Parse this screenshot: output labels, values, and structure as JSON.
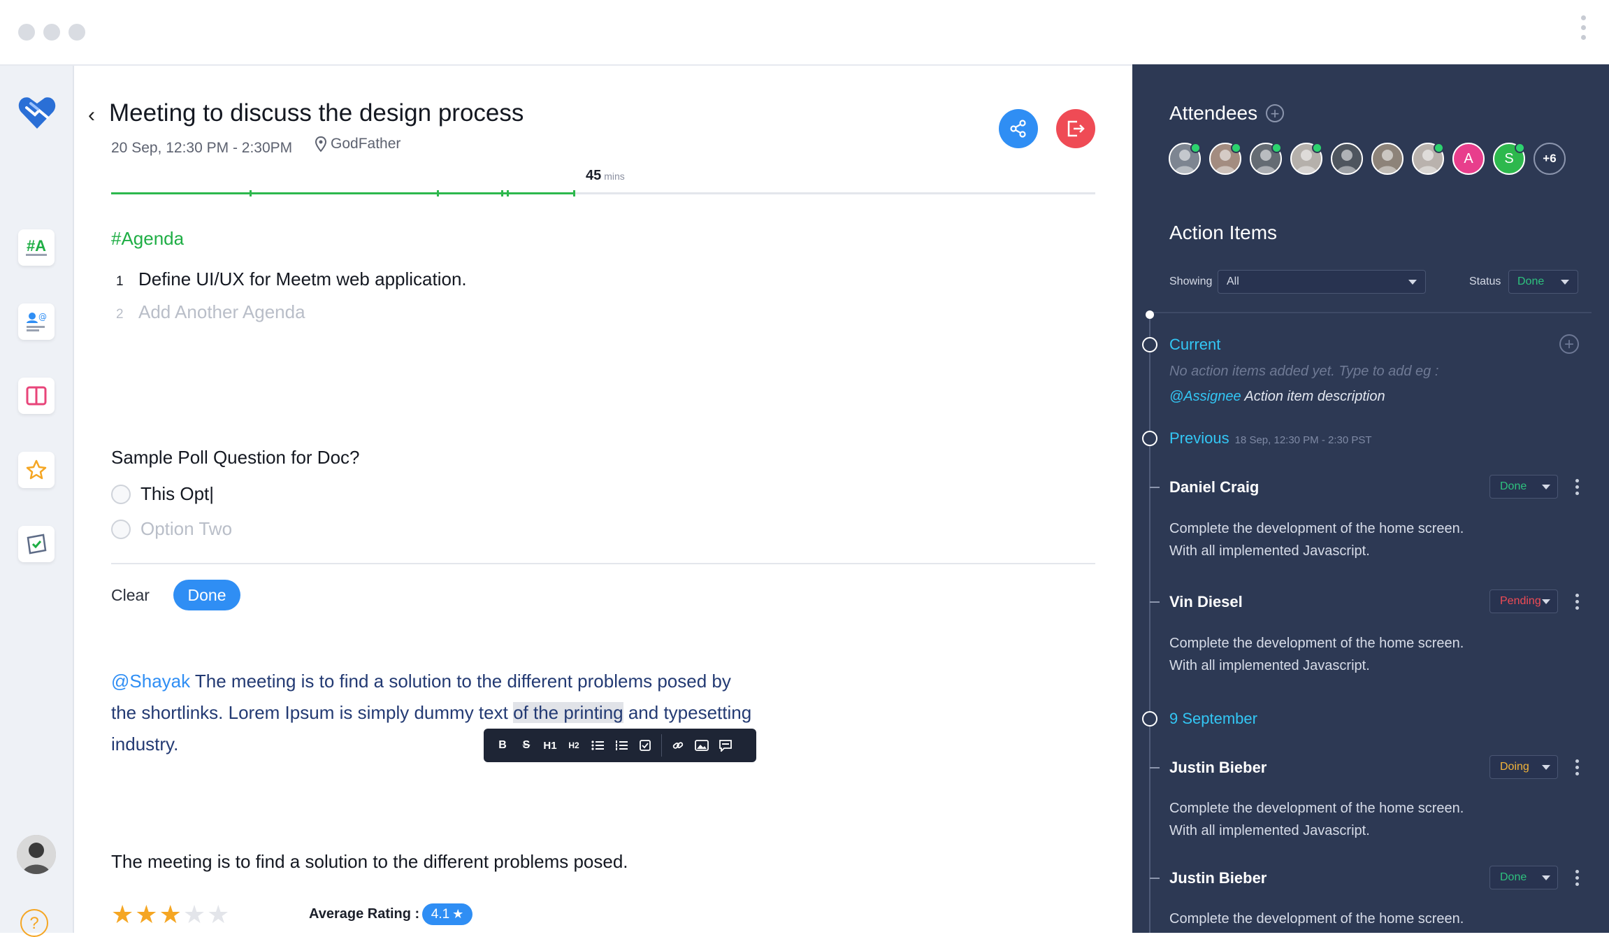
{
  "colors": {
    "accent_blue": "#2f8ef4",
    "agenda_green": "#1fae45",
    "danger_red": "#ef4b55",
    "panel_bg": "#2d3954",
    "cyan": "#33c7f5",
    "status_done": "#2ec27e",
    "status_pending": "#ef4b55",
    "status_doing": "#f2b43a",
    "star": "#f5a623"
  },
  "sidebar": {
    "logo_icon": "heart-handshake-icon",
    "items": [
      {
        "name": "agenda-hashtag-icon",
        "label": "#A"
      },
      {
        "name": "people-mention-icon"
      },
      {
        "name": "split-layout-icon"
      },
      {
        "name": "star-icon"
      },
      {
        "name": "inbox-check-icon"
      }
    ],
    "bottom": [
      {
        "name": "user-avatar"
      },
      {
        "name": "help-icon",
        "label": "?"
      }
    ]
  },
  "meeting": {
    "title": "Meeting to discuss the design process",
    "datetime": "20 Sep, 12:30 PM - 2:30PM",
    "location": "GodFather",
    "timer_value": "45",
    "timer_unit": "mins",
    "progress_fraction": 0.47
  },
  "agenda": {
    "heading": "#Agenda",
    "items": [
      {
        "num": "1",
        "text": "Define UI/UX for Meetm web application."
      },
      {
        "num": "2",
        "text": "Add Another Agenda"
      }
    ]
  },
  "poll": {
    "question": "Sample Poll Question for Doc?",
    "options": [
      {
        "text": "This Opt|"
      },
      {
        "text": "Option Two"
      }
    ],
    "clear_label": "Clear",
    "done_label": "Done"
  },
  "note": {
    "mention": "@Shayak",
    "text_before": " The meeting is to find a solution to the different problems posed by the shortlinks. Lorem Ipsum is simply dummy text ",
    "highlighted": "of the printing",
    "text_after": " and typesetting industry."
  },
  "toolbar": [
    "B",
    "S",
    "H1",
    "H2",
    "bullets",
    "numbered",
    "checkbox",
    "link",
    "image",
    "comment"
  ],
  "statement": "The meeting is to find a solution to the different problems posed.",
  "rating": {
    "stars": 3,
    "max": 5,
    "average_label": "Average Rating :",
    "average_value": "4.1"
  },
  "attendees": {
    "heading": "Attendees",
    "people": [
      {
        "initial": "",
        "color": "#7d8591",
        "online": true
      },
      {
        "initial": "",
        "color": "#a38c80",
        "online": true
      },
      {
        "initial": "",
        "color": "#646b73",
        "online": true
      },
      {
        "initial": "",
        "color": "#b5b0ab",
        "online": true
      },
      {
        "initial": "",
        "color": "#4e555e",
        "online": false
      },
      {
        "initial": "",
        "color": "#8d8379",
        "online": false
      },
      {
        "initial": "",
        "color": "#b9b2ad",
        "online": true
      },
      {
        "initial": "A",
        "color": "#e83e8c",
        "online": false
      },
      {
        "initial": "S",
        "color": "#2db84d",
        "online": true
      }
    ],
    "more_label": "+6"
  },
  "action_items": {
    "heading": "Action Items",
    "showing_label": "Showing",
    "showing_value": "All",
    "status_label": "Status",
    "status_value": "Done",
    "current_label": "Current",
    "empty_hint": "No action items added yet. Type to add eg :",
    "hint_mention": "@Assignee",
    "hint_rest": " Action item description",
    "previous_label": "Previous",
    "previous_time": "18 Sep, 12:30 PM - 2:30 PST",
    "september_label": "9 September",
    "items": [
      {
        "name": "Daniel Craig",
        "status": "Done",
        "line1": "Complete the development of the home screen.",
        "line2": "With all implemented Javascript."
      },
      {
        "name": "Vin Diesel",
        "status": "Pending",
        "line1": "Complete the development of the home screen.",
        "line2": "With all implemented Javascript."
      },
      {
        "name": "Justin Bieber",
        "status": "Doing",
        "line1": "Complete the development of the home screen.",
        "line2": "With all implemented Javascript."
      },
      {
        "name": "Justin Bieber",
        "status": "Done",
        "line1": "Complete the development of the home screen.",
        "line2": ""
      }
    ]
  }
}
